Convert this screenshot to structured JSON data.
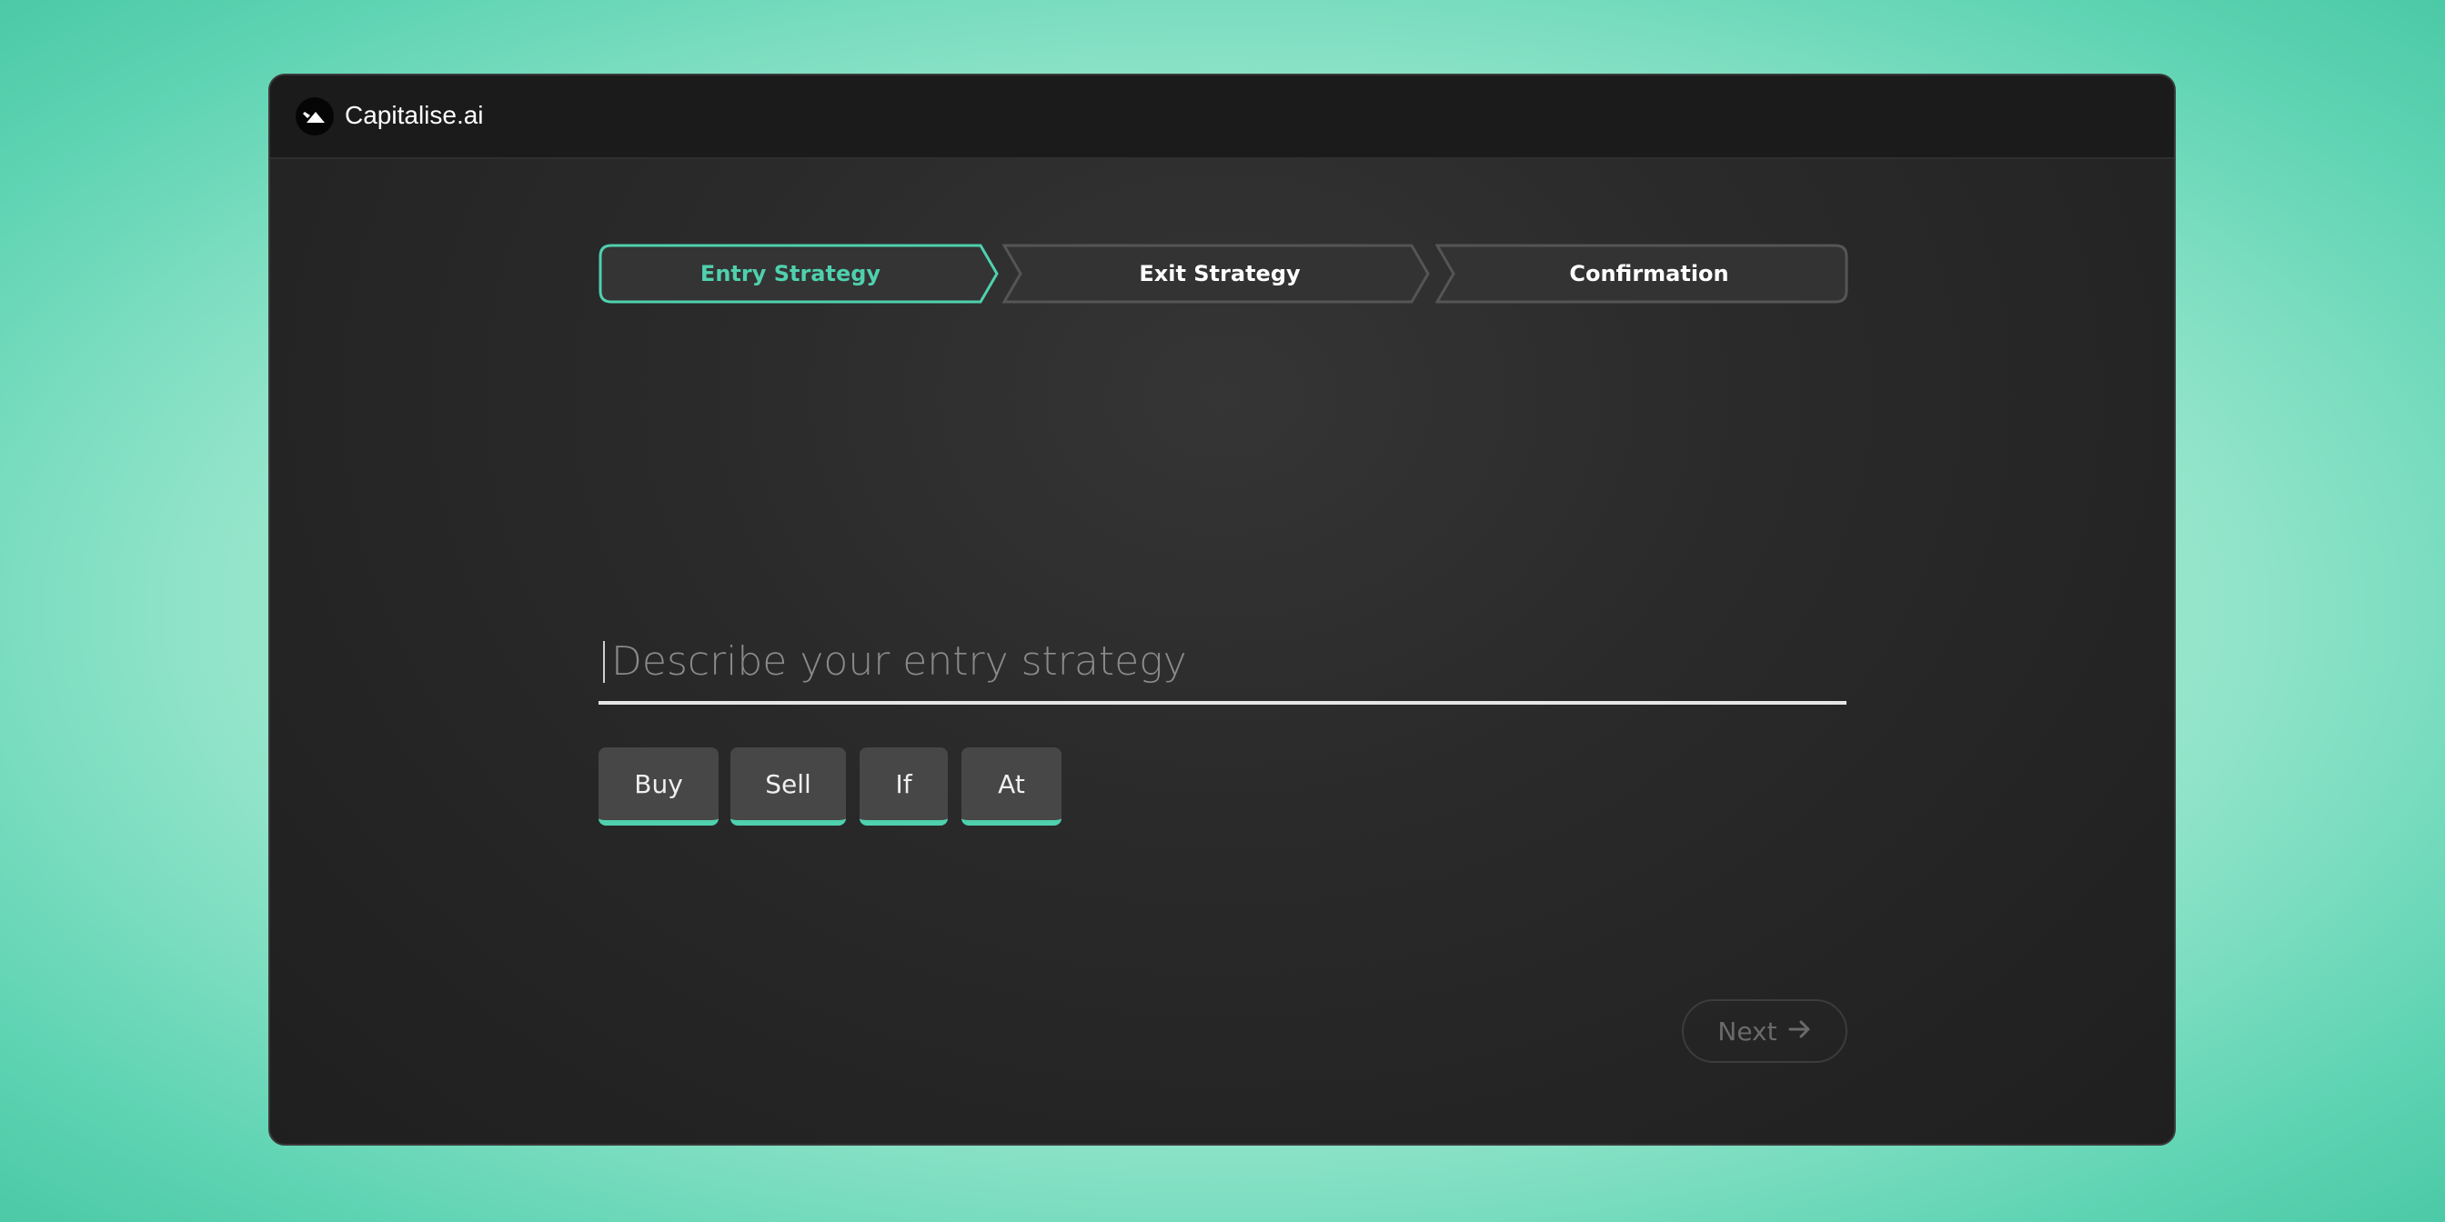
{
  "app": {
    "title": "Capitalise.ai",
    "logo_icon": "mountain-icon"
  },
  "colors": {
    "accent": "#4fd1ae",
    "window_bg": "#2a2a2a",
    "titlebar_bg": "#1b1b1b",
    "background": "#5fd4b3"
  },
  "steps": [
    {
      "label": "Entry Strategy",
      "active": true
    },
    {
      "label": "Exit Strategy",
      "active": false
    },
    {
      "label": "Confirmation",
      "active": false
    }
  ],
  "entry": {
    "value": "",
    "placeholder": "Describe your entry strategy"
  },
  "chips": [
    {
      "label": "Buy"
    },
    {
      "label": "Sell"
    },
    {
      "label": "If"
    },
    {
      "label": "At"
    }
  ],
  "footer": {
    "next_label": "Next",
    "next_icon": "arrow-right-icon"
  }
}
